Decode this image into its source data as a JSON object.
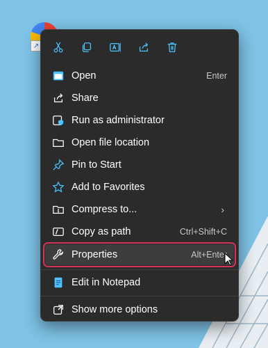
{
  "toolbar": [
    {
      "name": "cut-icon",
      "tooltip": "Cut"
    },
    {
      "name": "copy-icon",
      "tooltip": "Copy"
    },
    {
      "name": "rename-icon",
      "tooltip": "Rename"
    },
    {
      "name": "share-icon",
      "tooltip": "Share"
    },
    {
      "name": "delete-icon",
      "tooltip": "Delete"
    }
  ],
  "menu": {
    "items": [
      {
        "label": "Open",
        "shortcut": "Enter",
        "icon": "open-icon"
      },
      {
        "label": "Share",
        "shortcut": "",
        "icon": "share-icon"
      },
      {
        "label": "Run as administrator",
        "shortcut": "",
        "icon": "shield-icon"
      },
      {
        "label": "Open file location",
        "shortcut": "",
        "icon": "folder-icon"
      },
      {
        "label": "Pin to Start",
        "shortcut": "",
        "icon": "pin-icon"
      },
      {
        "label": "Add to Favorites",
        "shortcut": "",
        "icon": "star-icon"
      },
      {
        "label": "Compress to...",
        "shortcut": "",
        "icon": "zip-folder-icon",
        "submenu": true
      },
      {
        "label": "Copy as path",
        "shortcut": "Ctrl+Shift+C",
        "icon": "path-icon"
      },
      {
        "label": "Properties",
        "shortcut": "Alt+Enter",
        "icon": "wrench-icon",
        "highlighted": true
      },
      {
        "label": "Edit in Notepad",
        "shortcut": "",
        "icon": "notepad-icon"
      },
      {
        "label": "Show more options",
        "shortcut": "",
        "icon": "more-options-icon"
      }
    ]
  },
  "colors": {
    "highlight_border": "#d6335b",
    "menu_bg": "#2b2b2b",
    "accent": "#4cc2ff"
  }
}
